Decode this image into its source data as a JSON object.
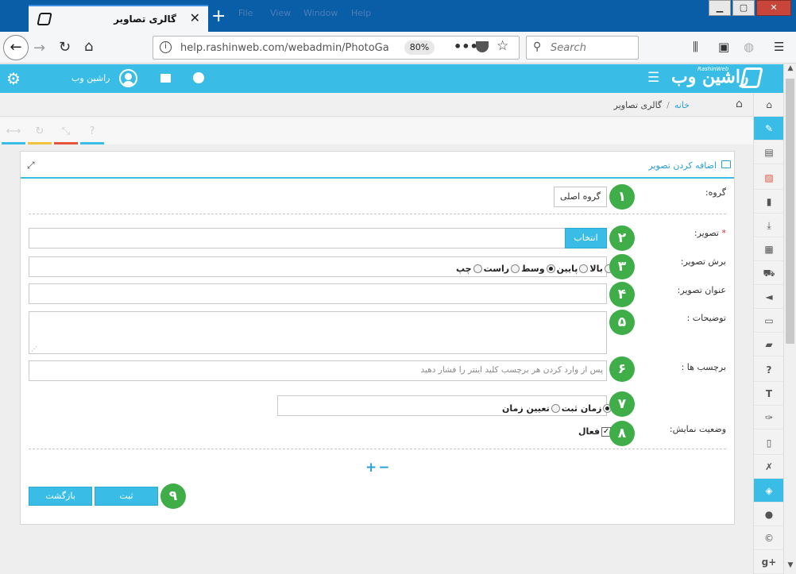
{
  "browser": {
    "tab_title": "گالری تصاویر",
    "url": "help.rashinweb.com/webadmin/PhotoGa",
    "zoom": "80%",
    "search_placeholder": "Search",
    "ghost_menu": [
      "File",
      "View",
      "Window",
      "Help"
    ]
  },
  "header": {
    "username": "راشین وب",
    "logo_text": "راشین وب",
    "logo_sub": "RashinWeb"
  },
  "breadcrumb": {
    "home": "خانه",
    "separator": "/",
    "current": "گالری تصاویر"
  },
  "panel": {
    "title": "اضافه کردن تصویر"
  },
  "form": {
    "group_label": "گروه:",
    "group_value": "گروه اصلی",
    "image_label": "تصویر:",
    "image_required": "*",
    "choose_button": "انتخاب",
    "crop_label": "برش تصویر:",
    "crop_options": [
      "بالا",
      "پایین",
      "وسط",
      "راست",
      "چپ"
    ],
    "crop_selected": "وسط",
    "image_title_label": "عنوان تصویر:",
    "description_label": "توضیحات :",
    "tags_label": "برچسب ها :",
    "tags_placeholder": "پس از وارد کردن هر برچسب کلید اینتر را فشار دهید",
    "time_options": [
      "زمان ثبت",
      "تعیین زمان"
    ],
    "time_selected": "زمان ثبت",
    "display_status_label": "وضعیت نمایش:",
    "active_label": "فعال",
    "active_checked": true,
    "plus_minus": "+−",
    "submit_button": "ثبت",
    "back_button": "بازگشت"
  },
  "badges": [
    "۱",
    "۲",
    "۳",
    "۴",
    "۵",
    "۶",
    "۷",
    "۸",
    "۹"
  ],
  "colors": {
    "accent": "#39bde6",
    "badge": "#3fae49",
    "required": "#d9272e",
    "tool_bars": [
      "#39bde6",
      "#f0c23b",
      "#e8533c",
      "#39bde6"
    ]
  },
  "sidebar_icons": [
    "home-icon",
    "pencil-icon",
    "id-card-icon",
    "image-icon",
    "file-icon",
    "download-icon",
    "film-icon",
    "cart-icon",
    "megaphone-icon",
    "monitor-icon",
    "book-icon",
    "question-icon",
    "text-height-icon",
    "pin-icon",
    "document-icon",
    "excel-icon",
    "gallery-icon",
    "user-icon",
    "copyright-icon",
    "google-plus-icon"
  ],
  "sidebar_active": "gallery-icon"
}
